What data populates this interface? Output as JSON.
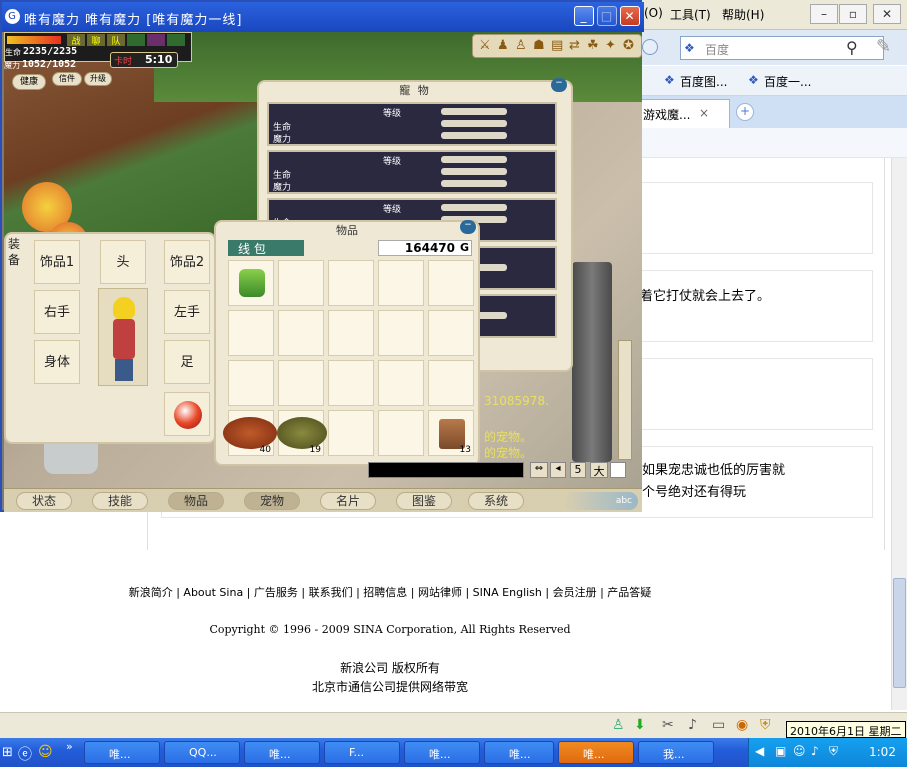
{
  "browser": {
    "menu": {
      "view_suffix": "(O)",
      "tools": "工具(T)",
      "help": "帮助(H)"
    },
    "search": {
      "placeholder": "百度"
    },
    "favorites": [
      "百度图...",
      "百度一..."
    ],
    "tab": {
      "label": "游戏魔...",
      "close": "×",
      "new": "+"
    },
    "posts": [
      {
        "text": ""
      },
      {
        "text": "着它打仗就会上去了。"
      },
      {
        "text": ""
      },
      {
        "text": "如果宠忠诚也低的厉害就",
        "text2": "个号绝对还有得玩"
      }
    ],
    "footer_links": "新浪简介 | About Sina | 广告服务 | 联系我们 | 招聘信息 | 网站律师 | SINA English | 会员注册 | 产品答疑",
    "copyright": "Copyright © 1996 - 2009 SINA Corporation, All Rights Reserved",
    "company": "新浪公司 版权所有",
    "bandwidth": "北京市通信公司提供网络带宽",
    "tooltip": "2010年6月1日 星期二"
  },
  "game": {
    "title": "唯有魔力  唯有魔力  [唯有魔力一线]",
    "hp_label": "生命",
    "hp": "2235/2235",
    "mp_label": "魔力",
    "mp": "1052/1052",
    "card_time_label": "卡时",
    "card_time": "5:10",
    "status_buttons": [
      "健康",
      "信件",
      "升级"
    ],
    "top_small": [
      "战",
      "聊",
      "队"
    ],
    "pet_panel": {
      "title": "寵  物",
      "rows": [
        {
          "level": "等级",
          "hp": "生命",
          "mp": "魔力"
        },
        {
          "level": "等级",
          "hp": "生命",
          "mp": "魔力"
        },
        {
          "level": "等级",
          "hp": "生命",
          "mp": ""
        }
      ]
    },
    "items_panel": {
      "title": "物品",
      "wallet": "线   包",
      "gold": "164470",
      "gold_unit": "G",
      "counts": {
        "roast": "40",
        "turtle": "19",
        "book": "13"
      }
    },
    "equip_panel": {
      "side": "装备",
      "slots": {
        "acc1": "饰品1",
        "head": "头",
        "acc2": "饰品2",
        "right": "右手",
        "left": "左手",
        "body": "身体",
        "foot": "足"
      }
    },
    "chat": {
      "line1": "31085978.",
      "line2": "的宠物。",
      "line3": "的宠物。",
      "buttons": [
        "5",
        "大"
      ]
    },
    "nav": [
      "状态",
      "技能",
      "物品",
      "宠物",
      "名片",
      "图鉴",
      "系统"
    ],
    "abc": "abc"
  },
  "taskbar": {
    "tasks": [
      "唯...",
      "QQ...",
      "唯...",
      "F...",
      "唯...",
      "唯...",
      "唯...",
      "我..."
    ],
    "time": "1:02"
  }
}
